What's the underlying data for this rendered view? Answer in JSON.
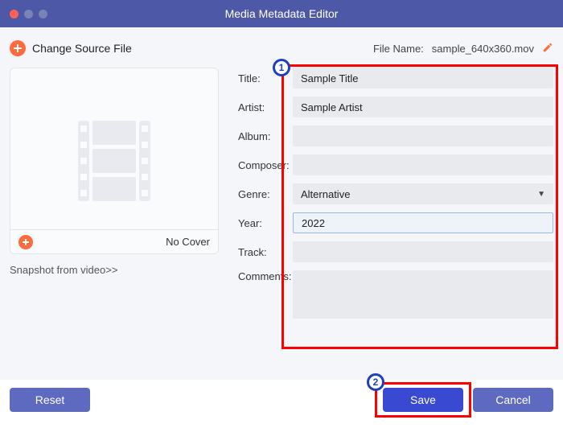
{
  "window": {
    "title": "Media Metadata Editor"
  },
  "toolbar": {
    "change_source": "Change Source File",
    "file_name_label": "File Name:",
    "file_name_value": "sample_640x360.mov"
  },
  "cover": {
    "no_cover": "No Cover",
    "snapshot": "Snapshot from video>>"
  },
  "fields": {
    "title_label": "Title:",
    "title_value": "Sample Title",
    "artist_label": "Artist:",
    "artist_value": "Sample Artist",
    "album_label": "Album:",
    "album_value": "",
    "composer_label": "Composer:",
    "composer_value": "",
    "genre_label": "Genre:",
    "genre_value": "Alternative",
    "year_label": "Year:",
    "year_value": "2022",
    "track_label": "Track:",
    "track_value": "",
    "comments_label": "Comments:",
    "comments_value": ""
  },
  "buttons": {
    "reset": "Reset",
    "save": "Save",
    "cancel": "Cancel"
  },
  "annotations": {
    "step1": "1",
    "step2": "2"
  }
}
